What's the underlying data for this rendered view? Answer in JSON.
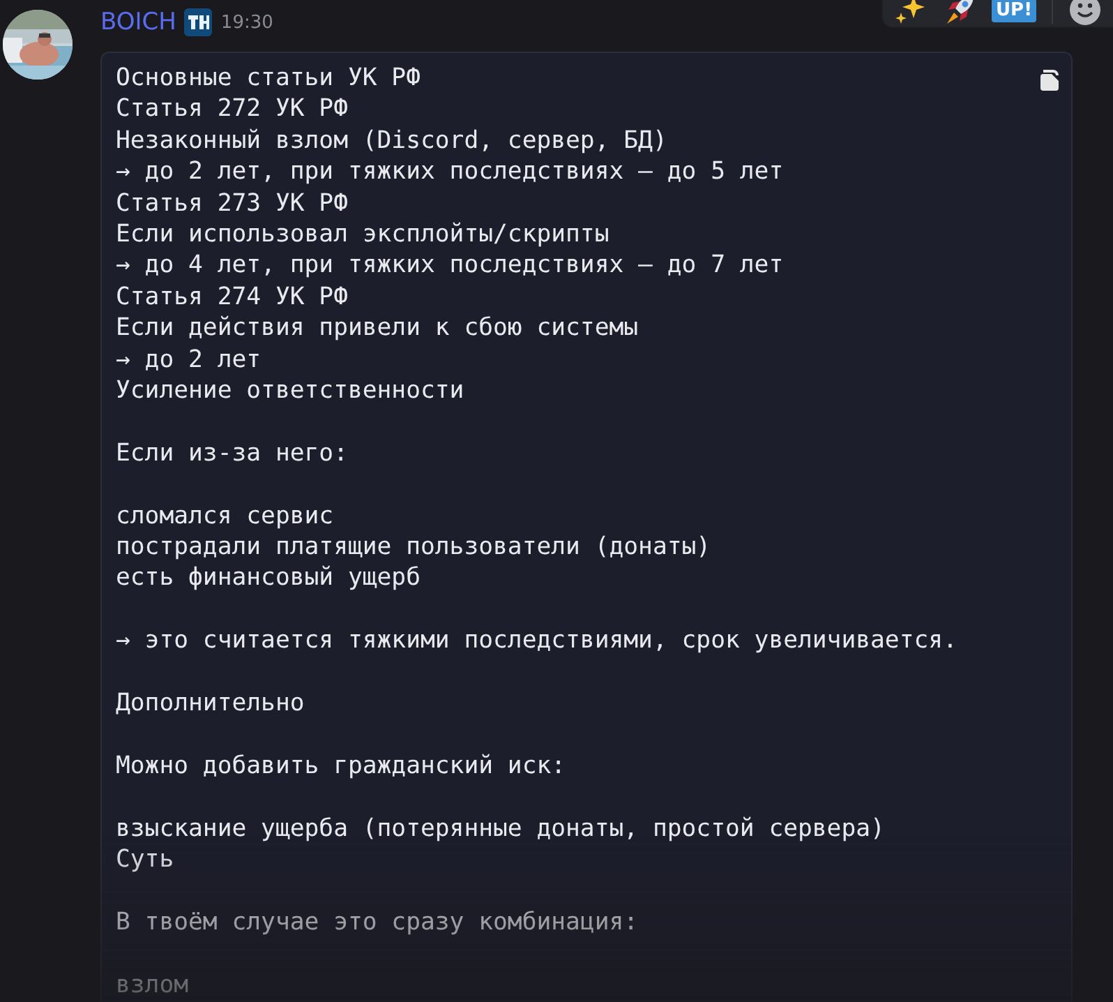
{
  "message": {
    "author": "BOICH",
    "time": "19:30",
    "code_blocks": [
      [
        "Основные статьи УК РФ",
        "Статья 272 УК РФ",
        "Незаконный взлом (Discord, сервер, БД)",
        "→ до 2 лет, при тяжких последствиях — до 5 лет",
        "Статья 273 УК РФ",
        "Если использовал эксплойты/скрипты",
        "→ до 4 лет, при тяжких последствиях — до 7 лет",
        "Статья 274 УК РФ",
        "Если действия привели к сбою системы",
        "→ до 2 лет",
        "Усиление ответственности"
      ],
      [
        "Если из-за него:"
      ],
      [
        "сломался сервис",
        "пострадали платящие пользователи (донаты)",
        "есть финансовый ущерб"
      ],
      [
        "→ это считается тяжкими последствиями, срок увеличивается."
      ],
      [
        "Дополнительно"
      ],
      [
        "Можно добавить гражданский иск:"
      ],
      [
        "взыскание ущерба (потерянные донаты, простой сервера)",
        "Суть"
      ],
      [
        "В твоём случае это сразу комбинация:"
      ],
      [
        "взлом"
      ]
    ]
  },
  "hover_toolbar": {
    "items": [
      {
        "kind": "sparkles"
      },
      {
        "kind": "rocket"
      },
      {
        "kind": "up",
        "text": "UP!"
      },
      {
        "kind": "smiley"
      }
    ]
  }
}
